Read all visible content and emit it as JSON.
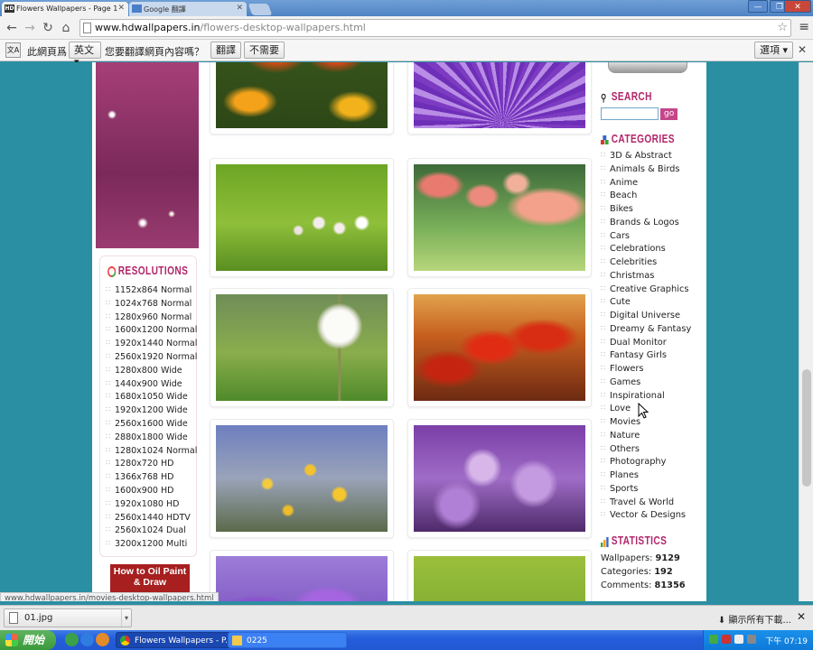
{
  "browser": {
    "tabs": [
      {
        "label": "Flowers Wallpapers - Page 1",
        "favicon": "HD",
        "active": true
      },
      {
        "label": "Google 翻譯",
        "active": false
      }
    ],
    "url_host": "www.hdwallpapers.in",
    "url_path": "/flowers-desktop-wallpapers.html",
    "translate_bar": {
      "prefix": "此網頁爲",
      "language": "英文",
      "question": "您要翻譯網頁內容嗎？",
      "translate_button": "翻譯",
      "no_button": "不需要",
      "options_button": "選項"
    },
    "status_url": "www.hdwallpapers.in/movies-desktop-wallpapers.html"
  },
  "site": {
    "resolutions": {
      "title": "RESOLUTIONS",
      "items": [
        "1152x864 Normal",
        "1024x768 Normal",
        "1280x960 Normal",
        "1600x1200 Normal",
        "1920x1440 Normal",
        "2560x1920 Normal",
        "1280x800 Wide",
        "1440x900 Wide",
        "1680x1050 Wide",
        "1920x1200 Wide",
        "2560x1600 Wide",
        "2880x1800 Wide",
        "1280x1024 Normal",
        "1280x720 HD",
        "1366x768 HD",
        "1600x900 HD",
        "1920x1080 HD",
        "2560x1440 HDTV",
        "2560x1024 Dual",
        "3200x1200 Multi"
      ]
    },
    "ad_text": "How to Oil Paint & Draw",
    "search": {
      "title": "SEARCH",
      "button": "go",
      "value": ""
    },
    "categories": {
      "title": "CATEGORIES",
      "items": [
        "3D & Abstract",
        "Animals & Birds",
        "Anime",
        "Beach",
        "Bikes",
        "Brands & Logos",
        "Cars",
        "Celebrations",
        "Celebrities",
        "Christmas",
        "Creative Graphics",
        "Cute",
        "Digital Universe",
        "Dreamy & Fantasy",
        "Dual Monitor",
        "Fantasy Girls",
        "Flowers",
        "Games",
        "Inspirational",
        "Love",
        "Movies",
        "Nature",
        "Others",
        "Photography",
        "Planes",
        "Sports",
        "Travel & World",
        "Vector & Designs"
      ]
    },
    "statistics": {
      "title": "STATISTICS",
      "rows": [
        {
          "label": "Wallpapers:",
          "value": "9129"
        },
        {
          "label": "Categories:",
          "value": "192"
        },
        {
          "label": "Comments:",
          "value": "81356"
        }
      ]
    },
    "thumbnails": [
      {
        "name": "orange-marigolds"
      },
      {
        "name": "purple-flower-closeup"
      },
      {
        "name": "white-clover-flowers"
      },
      {
        "name": "pink-tulips"
      },
      {
        "name": "dandelion"
      },
      {
        "name": "red-tulips"
      },
      {
        "name": "yellow-daisies"
      },
      {
        "name": "purple-lilac"
      },
      {
        "name": "purple-crocus"
      },
      {
        "name": "green-grass"
      }
    ]
  },
  "downloads": {
    "file": "01.jpg",
    "show_all": "顯示所有下載..."
  },
  "taskbar": {
    "start": "開始",
    "items": [
      {
        "label": "Flowers Wallpapers - P...",
        "active": true
      },
      {
        "label": "0225",
        "active": false
      }
    ],
    "clock": "下午 07:19"
  }
}
